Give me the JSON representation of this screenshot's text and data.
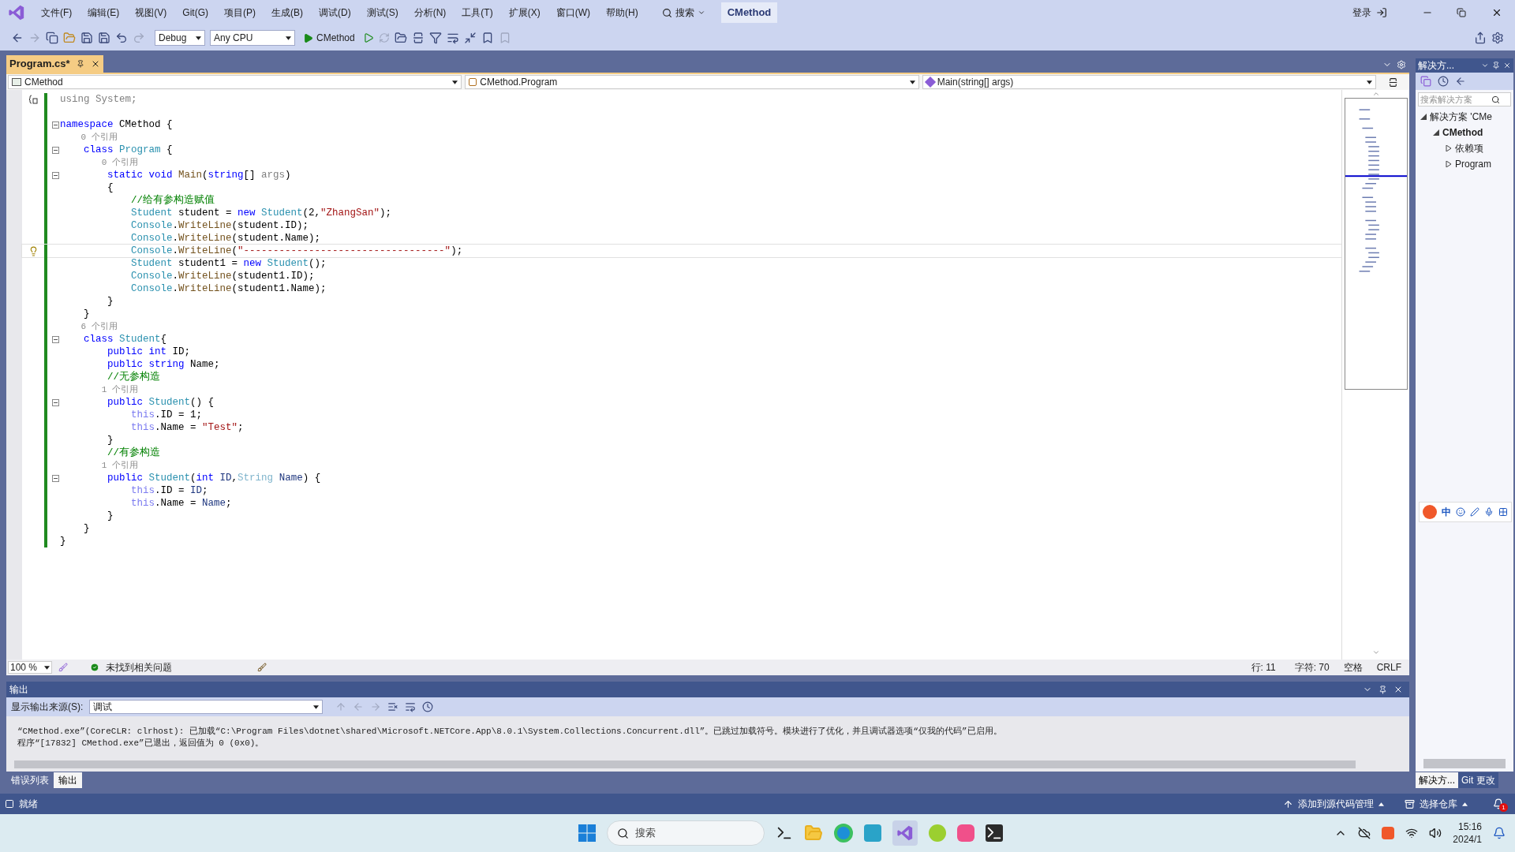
{
  "menu": [
    "文件(F)",
    "编辑(E)",
    "视图(V)",
    "Git(G)",
    "项目(P)",
    "生成(B)",
    "调试(D)",
    "测试(S)",
    "分析(N)",
    "工具(T)",
    "扩展(X)",
    "窗口(W)",
    "帮助(H)"
  ],
  "search": "搜索",
  "solution_name": "CMethod",
  "account": "登录",
  "toolbar": {
    "configuration": "Debug",
    "platform": "Any CPU",
    "start": "CMethod"
  },
  "doc_tabs": [
    {
      "label": "Program.cs*",
      "selected": true
    }
  ],
  "nav": {
    "project": "CMethod",
    "type": "CMethod.Program",
    "member": "Main(string[] args)"
  },
  "code_lines": [
    {
      "kind": "code",
      "tokens": [
        {
          "text": "using System;",
          "kind": "dim"
        }
      ]
    },
    {
      "kind": "blank"
    },
    {
      "kind": "code",
      "foldable": true,
      "tokens": [
        {
          "text": "namespace",
          "kind": "kw"
        },
        {
          "text": " CMethod {",
          "kind": "plain"
        }
      ]
    },
    {
      "kind": "refs",
      "text": "    0 个引用"
    },
    {
      "kind": "code",
      "foldable": true,
      "tokens": [
        {
          "text": "    class ",
          "kind": "kw"
        },
        {
          "text": "Program",
          "kind": "type"
        },
        {
          "text": " {",
          "kind": "plain"
        }
      ]
    },
    {
      "kind": "refs",
      "text": "        0 个引用"
    },
    {
      "kind": "code",
      "foldable": true,
      "tokens": [
        {
          "text": "        static void ",
          "kind": "kw"
        },
        {
          "text": "Main",
          "kind": "method"
        },
        {
          "text": "(",
          "kind": "plain"
        },
        {
          "text": "string",
          "kind": "kw"
        },
        {
          "text": "[] ",
          "kind": "plain"
        },
        {
          "text": "args",
          "kind": "dim"
        },
        {
          "text": ")",
          "kind": "plain"
        }
      ]
    },
    {
      "kind": "code",
      "tokens": [
        {
          "text": "        {",
          "kind": "plain"
        }
      ]
    },
    {
      "kind": "code",
      "tokens": [
        {
          "text": "            //给有参构造赋值",
          "kind": "comment"
        }
      ]
    },
    {
      "kind": "code",
      "tokens": [
        {
          "text": "            Student",
          "kind": "type"
        },
        {
          "text": " student = ",
          "kind": "plain"
        },
        {
          "text": "new ",
          "kind": "kw"
        },
        {
          "text": "Student",
          "kind": "type"
        },
        {
          "text": "(2,",
          "kind": "plain"
        },
        {
          "text": "\"ZhangSan\"",
          "kind": "str"
        },
        {
          "text": ");",
          "kind": "plain"
        }
      ]
    },
    {
      "kind": "code",
      "tokens": [
        {
          "text": "            Console",
          "kind": "type"
        },
        {
          "text": ".",
          "kind": "plain"
        },
        {
          "text": "WriteLine",
          "kind": "method"
        },
        {
          "text": "(student.ID);",
          "kind": "plain"
        }
      ]
    },
    {
      "kind": "code",
      "tokens": [
        {
          "text": "            Console",
          "kind": "type"
        },
        {
          "text": ".",
          "kind": "plain"
        },
        {
          "text": "WriteLine",
          "kind": "method"
        },
        {
          "text": "(student.Name);",
          "kind": "plain"
        }
      ]
    },
    {
      "kind": "code",
      "current": true,
      "tokens": [
        {
          "text": "            Console",
          "kind": "type"
        },
        {
          "text": ".",
          "kind": "plain"
        },
        {
          "text": "WriteLine",
          "kind": "method"
        },
        {
          "text": "(",
          "kind": "plain"
        },
        {
          "text": "\"----------------------------------\"",
          "kind": "str"
        },
        {
          "text": ");",
          "kind": "plain"
        }
      ]
    },
    {
      "kind": "code",
      "tokens": [
        {
          "text": "            Student",
          "kind": "type"
        },
        {
          "text": " student1 = ",
          "kind": "plain"
        },
        {
          "text": "new ",
          "kind": "kw"
        },
        {
          "text": "Student",
          "kind": "type"
        },
        {
          "text": "();",
          "kind": "plain"
        }
      ]
    },
    {
      "kind": "code",
      "tokens": [
        {
          "text": "            Console",
          "kind": "type"
        },
        {
          "text": ".",
          "kind": "plain"
        },
        {
          "text": "WriteLine",
          "kind": "method"
        },
        {
          "text": "(student1.ID);",
          "kind": "plain"
        }
      ]
    },
    {
      "kind": "code",
      "tokens": [
        {
          "text": "            Console",
          "kind": "type"
        },
        {
          "text": ".",
          "kind": "plain"
        },
        {
          "text": "WriteLine",
          "kind": "method"
        },
        {
          "text": "(student1.Name);",
          "kind": "plain"
        }
      ]
    },
    {
      "kind": "code",
      "tokens": [
        {
          "text": "        }",
          "kind": "plain"
        }
      ]
    },
    {
      "kind": "code",
      "tokens": [
        {
          "text": "    }",
          "kind": "plain"
        }
      ]
    },
    {
      "kind": "refs",
      "text": "    6 个引用"
    },
    {
      "kind": "code",
      "foldable": true,
      "tokens": [
        {
          "text": "    class ",
          "kind": "kw"
        },
        {
          "text": "Student",
          "kind": "type"
        },
        {
          "text": "{",
          "kind": "plain"
        }
      ]
    },
    {
      "kind": "code",
      "tokens": [
        {
          "text": "        public int",
          "kind": "kw"
        },
        {
          "text": " ID;",
          "kind": "plain"
        }
      ]
    },
    {
      "kind": "code",
      "tokens": [
        {
          "text": "        public string",
          "kind": "kw"
        },
        {
          "text": " Name;",
          "kind": "plain"
        }
      ]
    },
    {
      "kind": "code",
      "tokens": [
        {
          "text": "        //无参构造",
          "kind": "comment"
        }
      ]
    },
    {
      "kind": "refs",
      "text": "        1 个引用"
    },
    {
      "kind": "code",
      "foldable": true,
      "tokens": [
        {
          "text": "        public ",
          "kind": "kw"
        },
        {
          "text": "Student",
          "kind": "type"
        },
        {
          "text": "() {",
          "kind": "plain"
        }
      ]
    },
    {
      "kind": "code",
      "tokens": [
        {
          "text": "            this",
          "kind": "this"
        },
        {
          "text": ".ID = 1;",
          "kind": "plain"
        }
      ]
    },
    {
      "kind": "code",
      "tokens": [
        {
          "text": "            this",
          "kind": "this"
        },
        {
          "text": ".Name = ",
          "kind": "plain"
        },
        {
          "text": "\"Test\"",
          "kind": "str"
        },
        {
          "text": ";",
          "kind": "plain"
        }
      ]
    },
    {
      "kind": "code",
      "tokens": [
        {
          "text": "        }",
          "kind": "plain"
        }
      ]
    },
    {
      "kind": "code",
      "tokens": [
        {
          "text": "        //有参构造",
          "kind": "comment"
        }
      ]
    },
    {
      "kind": "refs",
      "text": "        1 个引用"
    },
    {
      "kind": "code",
      "foldable": true,
      "tokens": [
        {
          "text": "        public ",
          "kind": "kw"
        },
        {
          "text": "Student",
          "kind": "type"
        },
        {
          "text": "(",
          "kind": "plain"
        },
        {
          "text": "int ",
          "kind": "kw"
        },
        {
          "text": "ID",
          "kind": "param"
        },
        {
          "text": ",",
          "kind": "plain"
        },
        {
          "text": "String ",
          "kind": "lighttype"
        },
        {
          "text": "Name",
          "kind": "param"
        },
        {
          "text": ") {",
          "kind": "plain"
        }
      ]
    },
    {
      "kind": "code",
      "tokens": [
        {
          "text": "            this",
          "kind": "this"
        },
        {
          "text": ".ID = ",
          "kind": "plain"
        },
        {
          "text": "ID",
          "kind": "param"
        },
        {
          "text": ";",
          "kind": "plain"
        }
      ]
    },
    {
      "kind": "code",
      "tokens": [
        {
          "text": "            this",
          "kind": "this"
        },
        {
          "text": ".Name = ",
          "kind": "plain"
        },
        {
          "text": "Name",
          "kind": "param"
        },
        {
          "text": ";",
          "kind": "plain"
        }
      ]
    },
    {
      "kind": "code",
      "tokens": [
        {
          "text": "        }",
          "kind": "plain"
        }
      ]
    },
    {
      "kind": "code",
      "tokens": [
        {
          "text": "    }",
          "kind": "plain"
        }
      ]
    },
    {
      "kind": "code",
      "tokens": [
        {
          "text": "}",
          "kind": "plain"
        }
      ]
    }
  ],
  "editor_status": {
    "zoom": "100 %",
    "issues": "未找到相关问题",
    "line": "行: 11",
    "char": "字符: 70",
    "spacing": "空格",
    "eol": "CRLF"
  },
  "output": {
    "title": "输出",
    "source_label": "显示输出来源(S):",
    "source": "调试",
    "lines": [
      "“CMethod.exe”(CoreCLR: clrhost): 已加载“C:\\Program Files\\dotnet\\shared\\Microsoft.NETCore.App\\8.0.1\\System.Collections.Concurrent.dll”。已跳过加载符号。模块进行了优化，并且调试器选项“仅我的代码”已启用。",
      "程序“[17832] CMethod.exe”已退出，返回值为 0 (0x0)。"
    ]
  },
  "bottom_tabs": [
    {
      "label": "错误列表",
      "selected": false
    },
    {
      "label": "输出",
      "selected": true
    }
  ],
  "solution_explorer": {
    "title": "解决方...",
    "search_placeholder": "搜索解决方案",
    "tree": [
      {
        "label": "解决方案 'CMe",
        "expanded": true,
        "children": [
          {
            "label": "CMethod",
            "expanded": true,
            "children": [
              {
                "label": "依赖项",
                "expanded": false
              },
              {
                "label": "Program",
                "expanded": false
              }
            ]
          }
        ]
      }
    ]
  },
  "side_tabs": [
    {
      "label": "解决方...",
      "selected": true
    },
    {
      "label": "Git 更改",
      "selected": false
    }
  ],
  "ime": {
    "mode": "中"
  },
  "status_bar": {
    "ready": "就绪",
    "source_control": "添加到源代码管理",
    "repo": "选择仓库",
    "notifications": "1"
  },
  "taskbar": {
    "search": "搜索",
    "time": "15:16",
    "date": "2024/1"
  }
}
